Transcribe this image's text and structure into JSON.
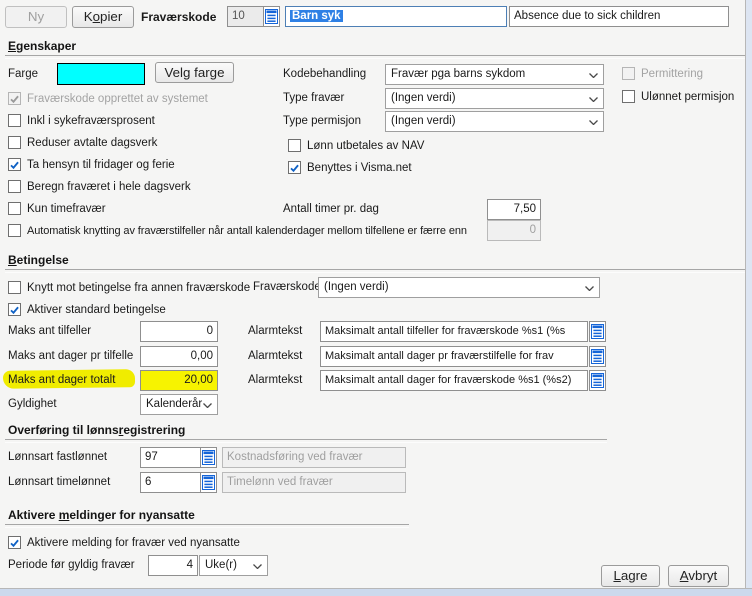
{
  "colors": {
    "swatch": "#00FFFF",
    "highlight_marker": "#F0EC00",
    "highlight_field": "#F7F300",
    "selection_bg": "#2E80E5",
    "icon_blue": "#1565D8"
  },
  "icons": {
    "lookup": "lookup-list-icon",
    "chevron": "chevron-down-icon",
    "check": "check-icon"
  },
  "toolbar": {
    "ny": "Ny",
    "kopier": {
      "text": "Kopier",
      "u": 1
    },
    "fravaerskode_label": "Fraværskode",
    "code_value": "10",
    "name_value": "Barn syk",
    "description_value": "Absence due to sick children"
  },
  "egenskaper": {
    "title": {
      "text": "Egenskaper",
      "u": 0
    },
    "farge_label": "Farge",
    "velg_farge": {
      "text": "Velg farge",
      "u": 3
    },
    "cb_system": "Fraværskode opprettet av systemet",
    "cb_inkl": "Inkl i sykefraværsprosent",
    "cb_reduser": "Reduser avtalte dagsverk",
    "cb_ta_hensyn": "Ta hensyn til fridager og ferie",
    "cb_beregn": "Beregn fraværet i hele dagsverk",
    "cb_kun": "Kun timefravær",
    "cb_auto": "Automatisk knytting av fraværstilfeller når antall kalenderdager mellom tilfellene er færre enn",
    "auto_value": "0",
    "kodebehandling_label": "Kodebehandling",
    "kodebehandling_value": "Fravær pga barns sykdom",
    "type_fravaer_label": "Type fravær",
    "type_fravaer_value": "(Ingen verdi)",
    "type_permisjon_label": "Type permisjon",
    "type_permisjon_value": "(Ingen verdi)",
    "cb_lonn_nav": "Lønn utbetales av NAV",
    "cb_benyttes": "Benyttes i Visma.net",
    "cb_permittering": "Permittering",
    "cb_ulonnet": "Ulønnet permisjon",
    "antall_timer_label": "Antall timer pr. dag",
    "antall_timer_value": "7,50"
  },
  "betingelse": {
    "title": {
      "text": "Betingelse",
      "u": 0
    },
    "cb_knytt": "Knytt mot betingelse fra annen fraværskode",
    "fravaerskode_label": "Fraværskode",
    "fravaerskode_value": "(Ingen verdi)",
    "cb_aktiver": "Aktiver standard betingelse",
    "alarm_label": "Alarmtekst",
    "rows": [
      {
        "label": "Maks ant tilfeller",
        "value": "0",
        "alarm": "Maksimalt antall tilfeller for fraværskode %s1 (%s"
      },
      {
        "label": "Maks ant dager pr tilfelle",
        "value": "0,00",
        "alarm": "Maksimalt antall dager pr fraværstilfelle for frav"
      },
      {
        "label": "Maks ant dager totalt",
        "value": "20,00",
        "alarm": "Maksimalt antall dager for fraværskode %s1 (%s2)"
      }
    ],
    "gyldighet_label": "Gyldighet",
    "gyldighet_value": "Kalenderår"
  },
  "overforing": {
    "title": {
      "text": "Overføring til lønnsregistrering",
      "u": 20
    },
    "fast_label": "Lønnsart fastlønnet",
    "fast_value": "97",
    "fast_desc": "Kostnadsføring ved fravær",
    "time_label": "Lønnsart timelønnet",
    "time_value": "6",
    "time_desc": "Timelønn ved fravær"
  },
  "aktivere": {
    "title": {
      "text": "Aktivere meldinger for nyansatte",
      "u": 9
    },
    "cb_melding": "Aktivere melding for fravær ved nyansatte",
    "periode_label": "Periode før gyldig fravær",
    "periode_value": "4",
    "periode_unit": "Uke(r)"
  },
  "footer": {
    "lagre": {
      "text": "Lagre",
      "u": 0
    },
    "avbryt": {
      "text": "Avbryt",
      "u": 0
    }
  }
}
